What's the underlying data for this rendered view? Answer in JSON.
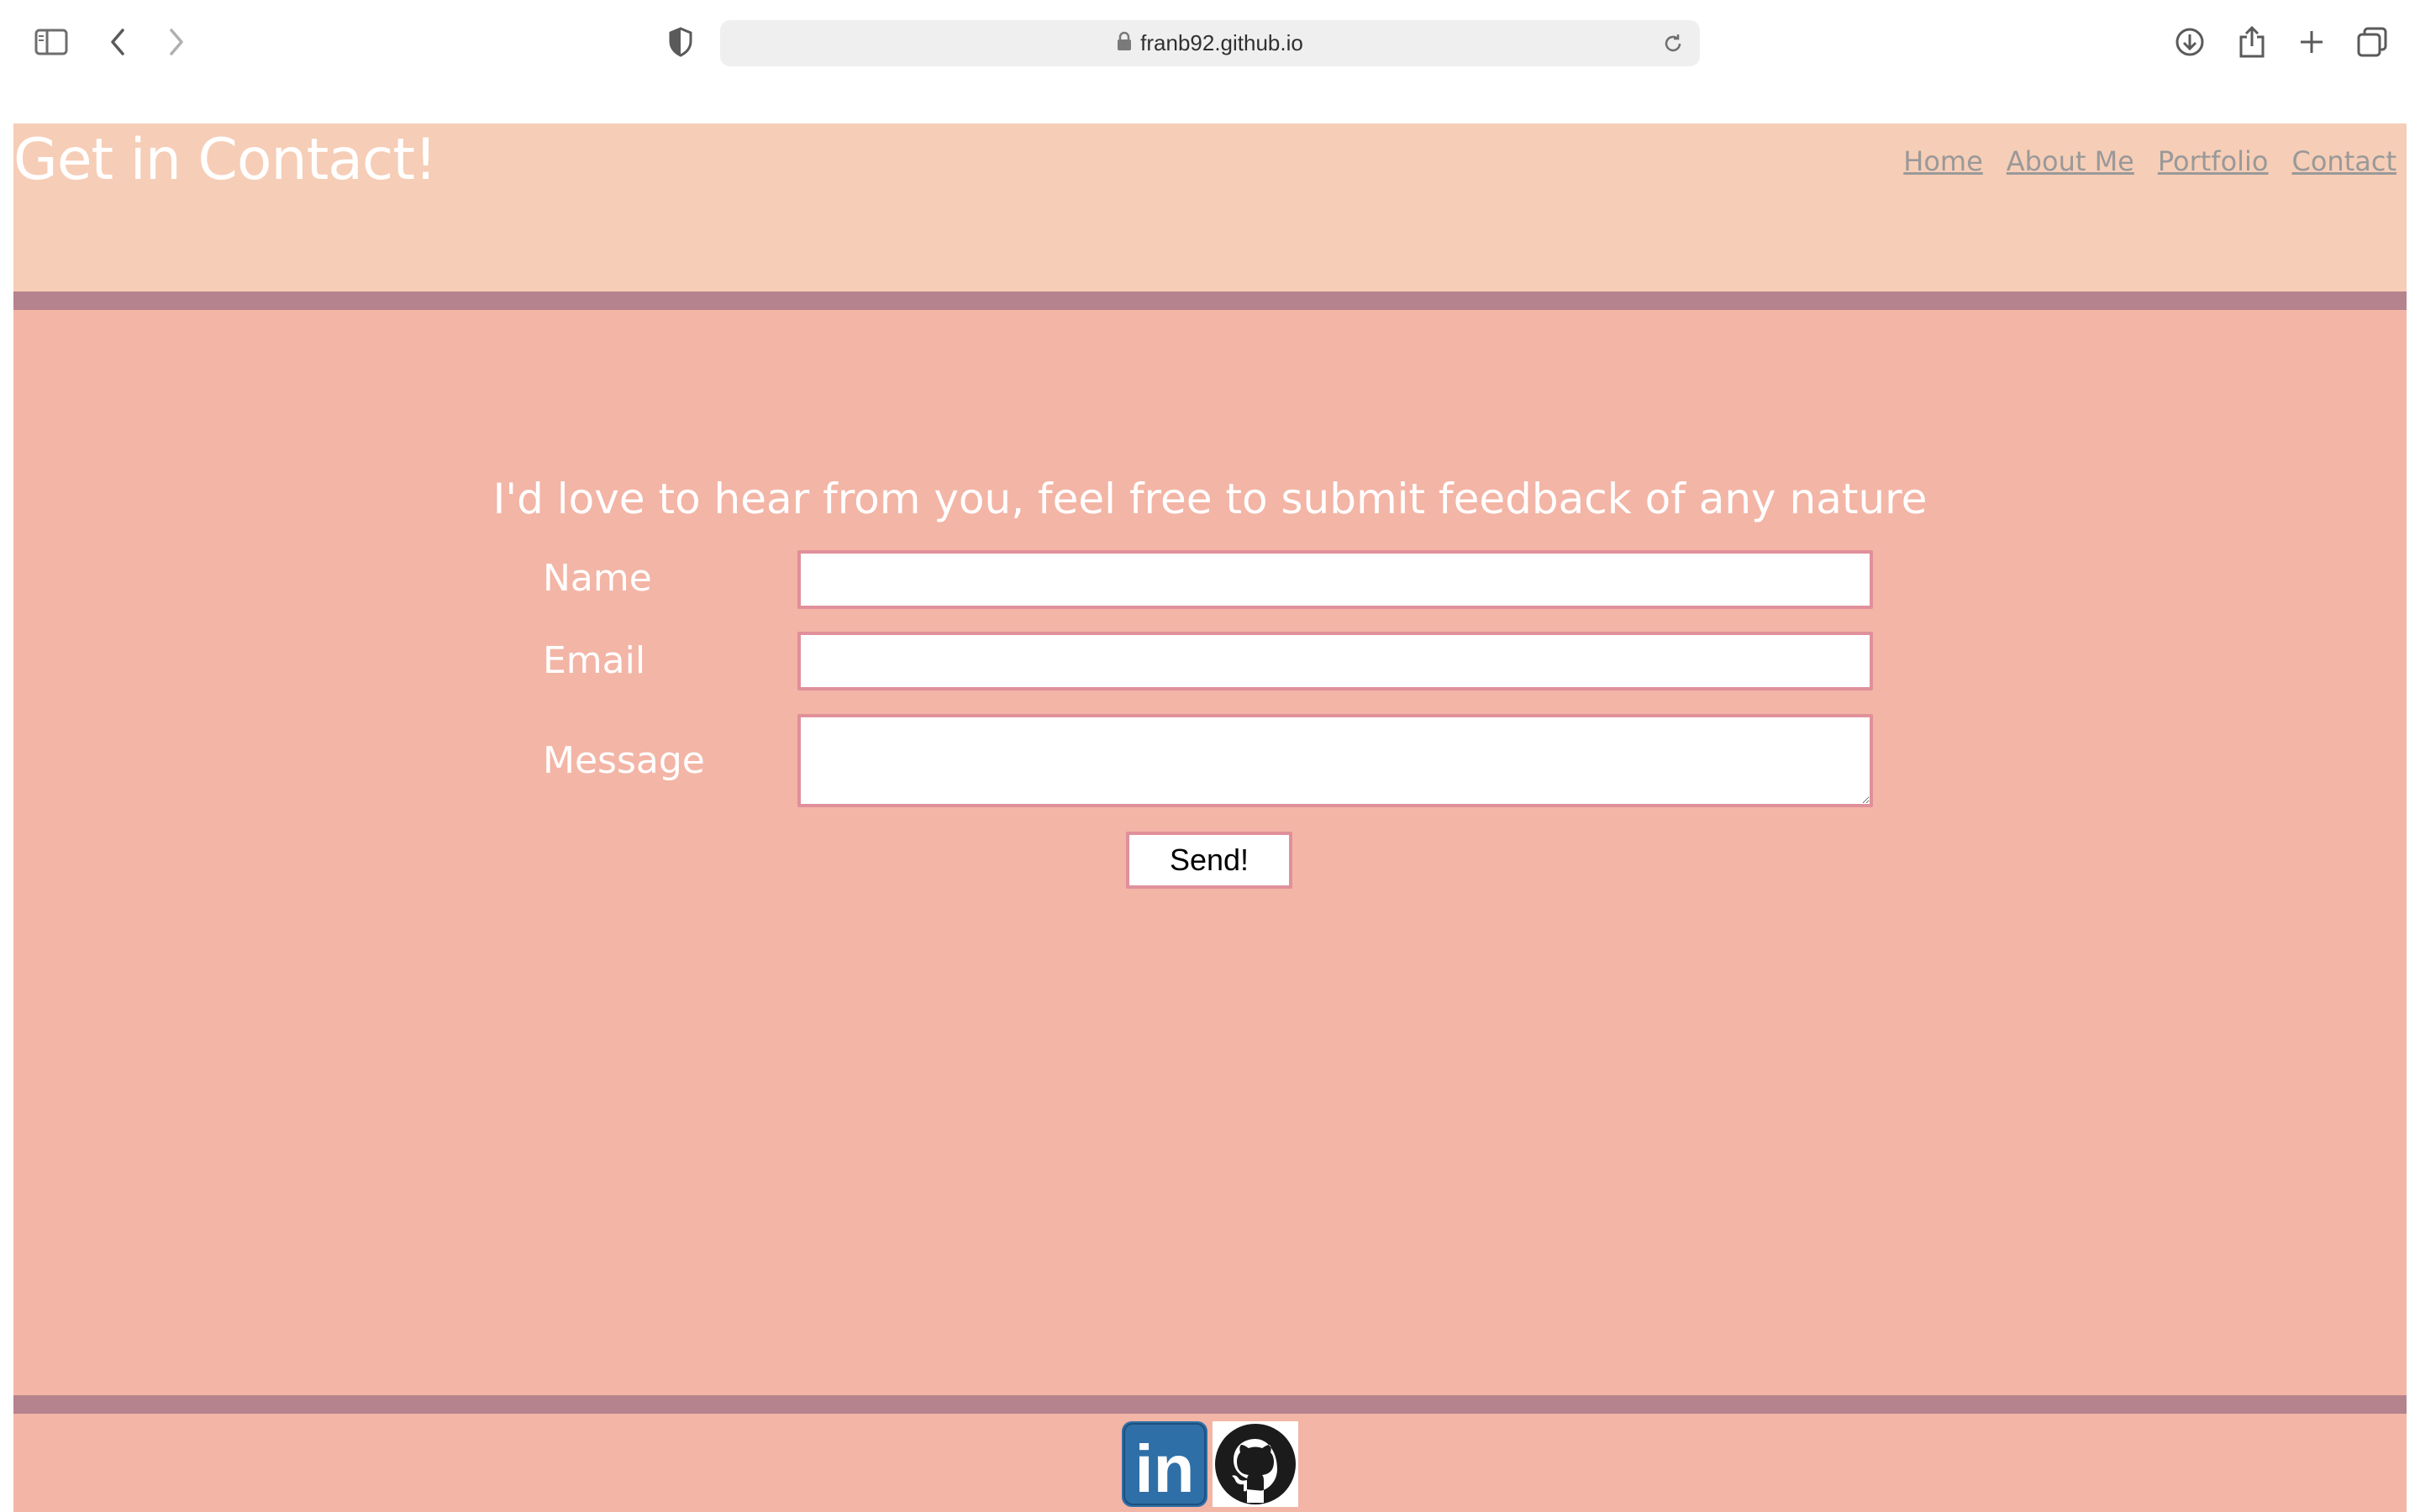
{
  "browser": {
    "url_host": "franb92.github.io",
    "icons": [
      "sidebar-icon",
      "back-icon",
      "forward-icon",
      "privacy-shield-icon",
      "lock-icon",
      "reload-icon",
      "download-icon",
      "share-icon",
      "new-tab-icon",
      "tab-overview-icon"
    ]
  },
  "header": {
    "title": "Get in Contact!",
    "nav": [
      "Home",
      "About Me",
      "Portfolio",
      "Contact"
    ]
  },
  "main": {
    "intro": "I'd love to hear from you, feel free to submit feedback of any nature",
    "form": {
      "name_label": "Name",
      "name_value": "",
      "email_label": "Email",
      "email_value": "",
      "message_label": "Message",
      "message_value": "",
      "submit_label": "Send!"
    }
  },
  "footer": {
    "social": [
      "linkedin-icon",
      "github-icon"
    ],
    "linkedin_text": "in"
  },
  "colors": {
    "header_bg": "#f6cdb6",
    "page_bg": "#f3b5a6",
    "band": "#b5838d",
    "field_border": "#e0909a",
    "nav_link": "#999999",
    "linkedin": "#2f6fa7"
  }
}
